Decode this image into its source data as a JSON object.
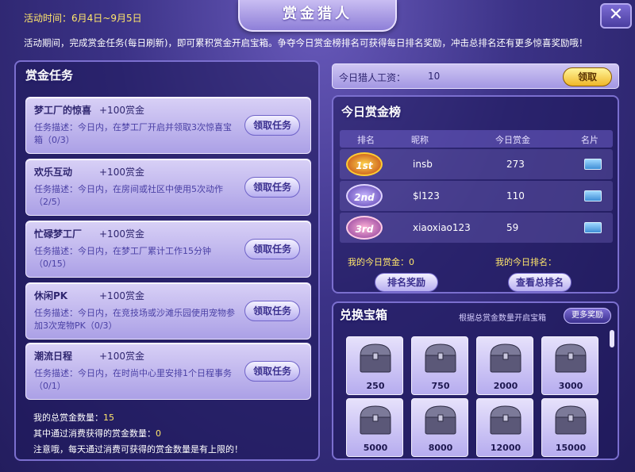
{
  "header": {
    "event_time_label": "活动时间",
    "event_time_value": "6月4日~9月5日",
    "title": "赏金猎人",
    "close_glyph": "✕",
    "description": "活动期间，完成赏金任务(每日刷新)，即可累积赏金开启宝箱。争夺今日赏金榜排名可获得每日排名奖励，冲击总排名还有更多惊喜奖励哦！"
  },
  "tasks": {
    "title": "赏金任务",
    "items": [
      {
        "name": "梦工厂的惊喜",
        "reward": "+100赏金",
        "desc": "任务描述：今日内，在梦工厂开启并领取3次惊喜宝箱（0/3）",
        "button": "领取任务"
      },
      {
        "name": "欢乐互动",
        "reward": "+100赏金",
        "desc": "任务描述：今日内，在房间或社区中使用5次动作（2/5）",
        "button": "领取任务"
      },
      {
        "name": "忙碌梦工厂",
        "reward": "+100赏金",
        "desc": "任务描述：今日内，在梦工厂累计工作15分钟（0/15）",
        "button": "领取任务"
      },
      {
        "name": "休闲PK",
        "reward": "+100赏金",
        "desc": "任务描述：今日内，在竞技场或沙滩乐园使用宠物参加3次宠物PK（0/3）",
        "button": "领取任务"
      },
      {
        "name": "潮流日程",
        "reward": "+100赏金",
        "desc": "任务描述：今日内，在时尚中心里安排1个日程事务（0/1）",
        "button": "领取任务"
      }
    ],
    "footer": {
      "total_label": "我的总赏金数量：",
      "total_value": "15",
      "consume_label": "其中通过消费获得的赏金数量：",
      "consume_value": "0",
      "note": "注意哦，每天通过消费可获得的赏金数量是有上限的！"
    }
  },
  "wage": {
    "label": "今日猎人工资：",
    "value": "10",
    "button": "领取"
  },
  "leaderboard": {
    "title": "今日赏金榜",
    "columns": [
      "排名",
      "昵称",
      "今日赏金",
      "名片"
    ],
    "rows": [
      {
        "badge": "1st",
        "name": "insb",
        "score": "273"
      },
      {
        "badge": "2nd",
        "name": "$l123",
        "score": "110"
      },
      {
        "badge": "3rd",
        "name": "xiaoxiao123",
        "score": "59"
      }
    ],
    "my_score_label": "我的今日赏金：",
    "my_score_value": "0",
    "my_rank_label": "我的今日排名：",
    "my_rank_value": "",
    "rank_reward_button": "排名奖励",
    "total_rank_button": "查看总排名"
  },
  "chests": {
    "title": "兑换宝箱",
    "hint": "根据总赏金数量开启宝箱",
    "more_button": "更多奖励",
    "items": [
      {
        "label": "250"
      },
      {
        "label": "750"
      },
      {
        "label": "2000"
      },
      {
        "label": "3000"
      },
      {
        "label": "5000"
      },
      {
        "label": "8000"
      },
      {
        "label": "12000"
      },
      {
        "label": "15000"
      }
    ]
  },
  "colors": {
    "accent_yellow": "#ffe66b",
    "panel_border": "#7b6fcf",
    "card_bg": "#c9bff2",
    "button_text": "#3a2f8f"
  }
}
